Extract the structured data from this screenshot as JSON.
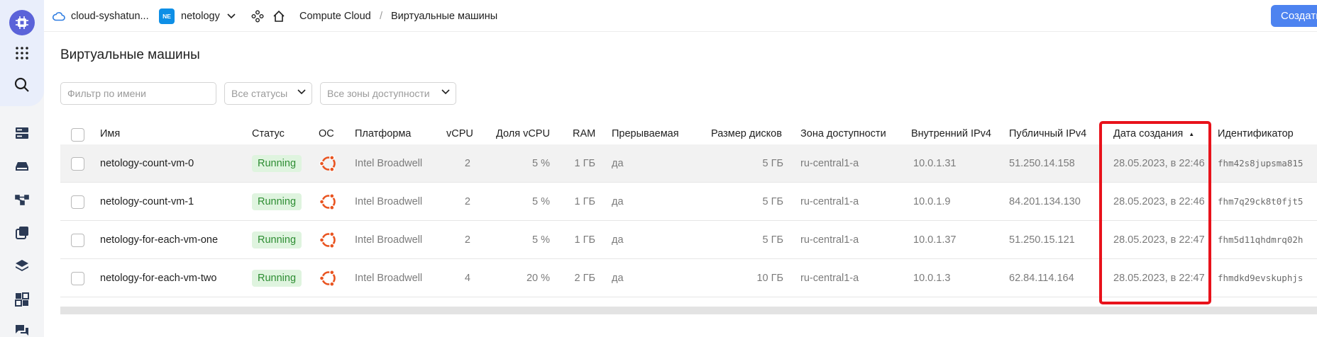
{
  "header": {
    "cloud_name": "cloud-syshatun...",
    "folder_badge": "NE",
    "folder_name": "netology",
    "breadcrumb_service": "Compute Cloud",
    "breadcrumb_separator": "/",
    "breadcrumb_page": "Виртуальные машины",
    "create_label": "Создать"
  },
  "page": {
    "title": "Виртуальные машины"
  },
  "filters": {
    "name_placeholder": "Фильтр по имени",
    "status_label": "Все статусы",
    "zone_label": "Все зоны доступности"
  },
  "table": {
    "columns": {
      "name": "Имя",
      "status": "Статус",
      "os": "ОС",
      "platform": "Платформа",
      "vcpu": "vCPU",
      "vcpu_share": "Доля vCPU",
      "ram": "RAM",
      "preemptible": "Прерываемая",
      "disk": "Размер дисков",
      "zone": "Зона доступности",
      "ipv4_internal": "Внутренний IPv4",
      "ipv4_public": "Публичный IPv4",
      "created": "Дата создания",
      "id": "Идентификатор"
    },
    "sort_indicator": "▲",
    "rows": [
      {
        "name": "netology-count-vm-0",
        "status": "Running",
        "platform": "Intel Broadwell",
        "vcpu": "2",
        "vcpu_share": "5 %",
        "ram": "1 ГБ",
        "preemptible": "да",
        "disk": "5 ГБ",
        "zone": "ru-central1-a",
        "ipv4_internal": "10.0.1.31",
        "ipv4_public": "51.250.14.158",
        "created": "28.05.2023, в 22:46",
        "id": "fhm42s8jupsma815"
      },
      {
        "name": "netology-count-vm-1",
        "status": "Running",
        "platform": "Intel Broadwell",
        "vcpu": "2",
        "vcpu_share": "5 %",
        "ram": "1 ГБ",
        "preemptible": "да",
        "disk": "5 ГБ",
        "zone": "ru-central1-a",
        "ipv4_internal": "10.0.1.9",
        "ipv4_public": "84.201.134.130",
        "created": "28.05.2023, в 22:46",
        "id": "fhm7q29ck8t0fjt5"
      },
      {
        "name": "netology-for-each-vm-one",
        "status": "Running",
        "platform": "Intel Broadwell",
        "vcpu": "2",
        "vcpu_share": "5 %",
        "ram": "1 ГБ",
        "preemptible": "да",
        "disk": "5 ГБ",
        "zone": "ru-central1-a",
        "ipv4_internal": "10.0.1.37",
        "ipv4_public": "51.250.15.121",
        "created": "28.05.2023, в 22:47",
        "id": "fhm5d11qhdmrq02h"
      },
      {
        "name": "netology-for-each-vm-two",
        "status": "Running",
        "platform": "Intel Broadwell",
        "vcpu": "4",
        "vcpu_share": "20 %",
        "ram": "2 ГБ",
        "preemptible": "да",
        "disk": "10 ГБ",
        "zone": "ru-central1-a",
        "ipv4_internal": "10.0.1.3",
        "ipv4_public": "62.84.114.164",
        "created": "28.05.2023, в 22:47",
        "id": "fhmdkd9evskuphjs"
      }
    ]
  },
  "icons": {
    "sidebar": [
      "compute-cloud-logo",
      "apps-grid-icon",
      "search-icon",
      "server-icon",
      "storage-icon",
      "network-icon",
      "copy-icon",
      "layers-icon",
      "dashboard-icon",
      "chat-icon"
    ],
    "os": "ubuntu-icon"
  },
  "colors": {
    "accent": "#4d83f0",
    "logo": "#5b63d9",
    "status_bg": "#dff4df",
    "status_text": "#2d8d32",
    "ubuntu": "#e95420",
    "annotation": "#e8121b"
  }
}
